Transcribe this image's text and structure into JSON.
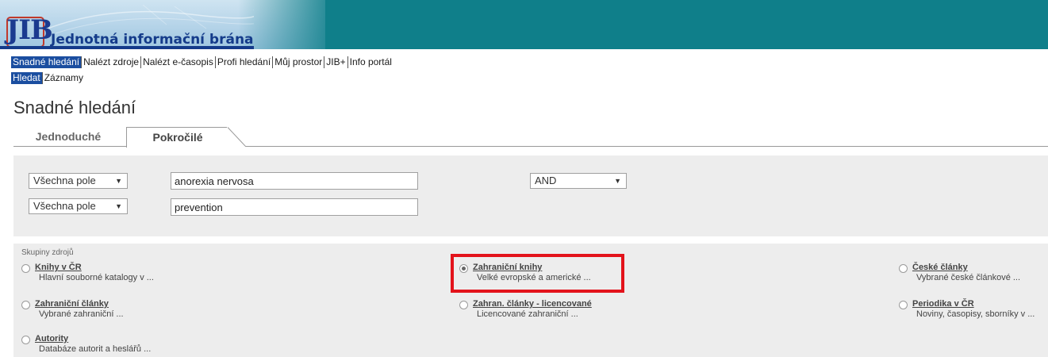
{
  "header": {
    "logo_text": "JIB",
    "site_title": "Jednotná informační brána"
  },
  "topnav": {
    "items": [
      {
        "label": "Snadné hledání",
        "active": true
      },
      {
        "label": "Nalézt zdroje",
        "active": false
      },
      {
        "label": "Nalézt e-časopis",
        "active": false
      },
      {
        "label": "Profi hledání",
        "active": false
      },
      {
        "label": "Můj prostor",
        "active": false
      },
      {
        "label": "JIB+",
        "active": false
      },
      {
        "label": "Info portál",
        "active": false
      }
    ]
  },
  "subnav": {
    "items": [
      {
        "label": "Hledat",
        "active": true
      },
      {
        "label": "Záznamy",
        "active": false
      }
    ]
  },
  "page_title": "Snadné hledání",
  "tabs": [
    {
      "label": "Jednoduché",
      "selected": false
    },
    {
      "label": "Pokročilé",
      "selected": true
    }
  ],
  "search": {
    "rows": [
      {
        "field": "Všechna pole",
        "value": "anorexia nervosa"
      },
      {
        "field": "Všechna pole",
        "value": "prevention"
      }
    ],
    "operator": "AND"
  },
  "groups": {
    "heading": "Skupiny zdrojů",
    "items": [
      {
        "title": "Knihy v ČR",
        "desc": "Hlavní souborné katalogy v ...",
        "checked": false
      },
      {
        "title": "Zahraniční knihy",
        "desc": "Velké evropské a americké ...",
        "checked": true
      },
      {
        "title": "České články",
        "desc": "Vybrané české článkové ...",
        "checked": false
      },
      {
        "title": "Zahraniční články",
        "desc": "Vybrané zahraniční ...",
        "checked": false
      },
      {
        "title": "Zahran. články - licencované",
        "desc": "Licencované zahraniční ...",
        "checked": false
      },
      {
        "title": "Periodika v ČR",
        "desc": "Noviny, časopisy, sborníky v ...",
        "checked": false
      },
      {
        "title": "Autority",
        "desc": "Databáze autorit a heslářů ...",
        "checked": false
      }
    ]
  },
  "colors": {
    "banner": "#0f7f8a",
    "nav_active": "#1b4ea0",
    "highlight": "#e3131b",
    "panel": "#ededed"
  }
}
